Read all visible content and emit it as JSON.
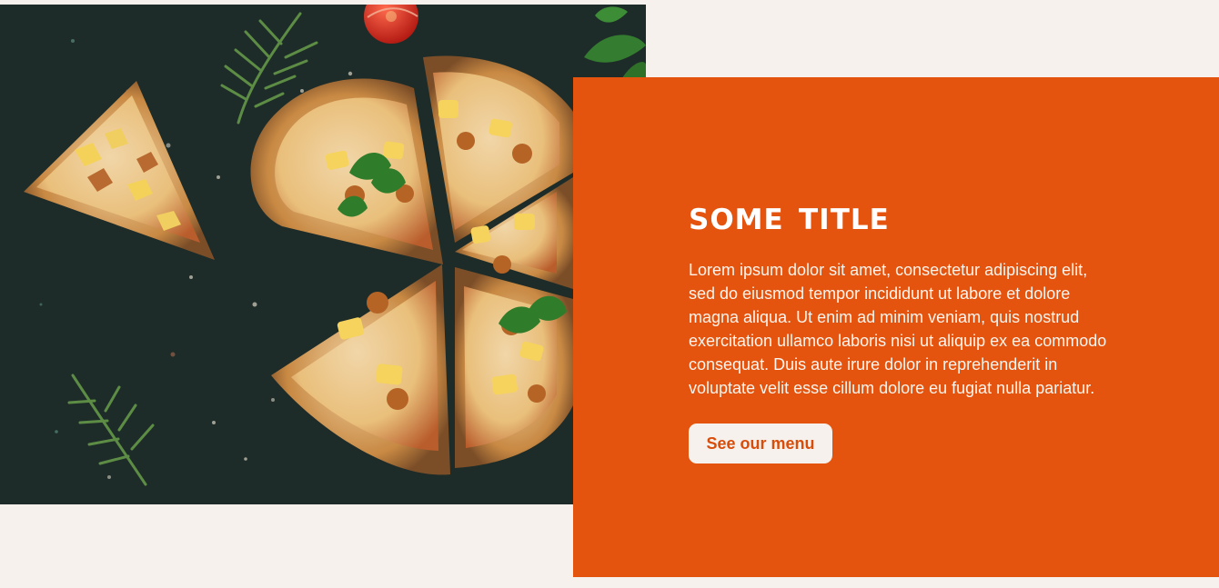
{
  "hero": {
    "image_alt": "Pizza slices with pineapple, chicken, basil and herbs on a dark textured surface"
  },
  "promo": {
    "title": "Some title",
    "body": "Lorem ipsum dolor sit amet, consectetur adipiscing elit, sed do eiusmod tempor incididunt ut labore et dolore magna aliqua. Ut enim ad minim veniam, quis nostrud exercitation ullamco laboris nisi ut aliquip ex ea commodo consequat. Duis aute irure dolor in reprehenderit in voluptate velit esse cillum dolore eu fugiat nulla pariatur.",
    "button_label": "See our menu"
  },
  "colors": {
    "background": "#f6f1ed",
    "accent": "#e4540e",
    "button_text": "#d94d0b",
    "button_background": "#f6f1ed"
  },
  "icons": {
    "pizza": "pizza-image",
    "rosemary": "rosemary-sprig-icon",
    "basil": "basil-leaf-icon",
    "tomato": "tomato-icon"
  }
}
